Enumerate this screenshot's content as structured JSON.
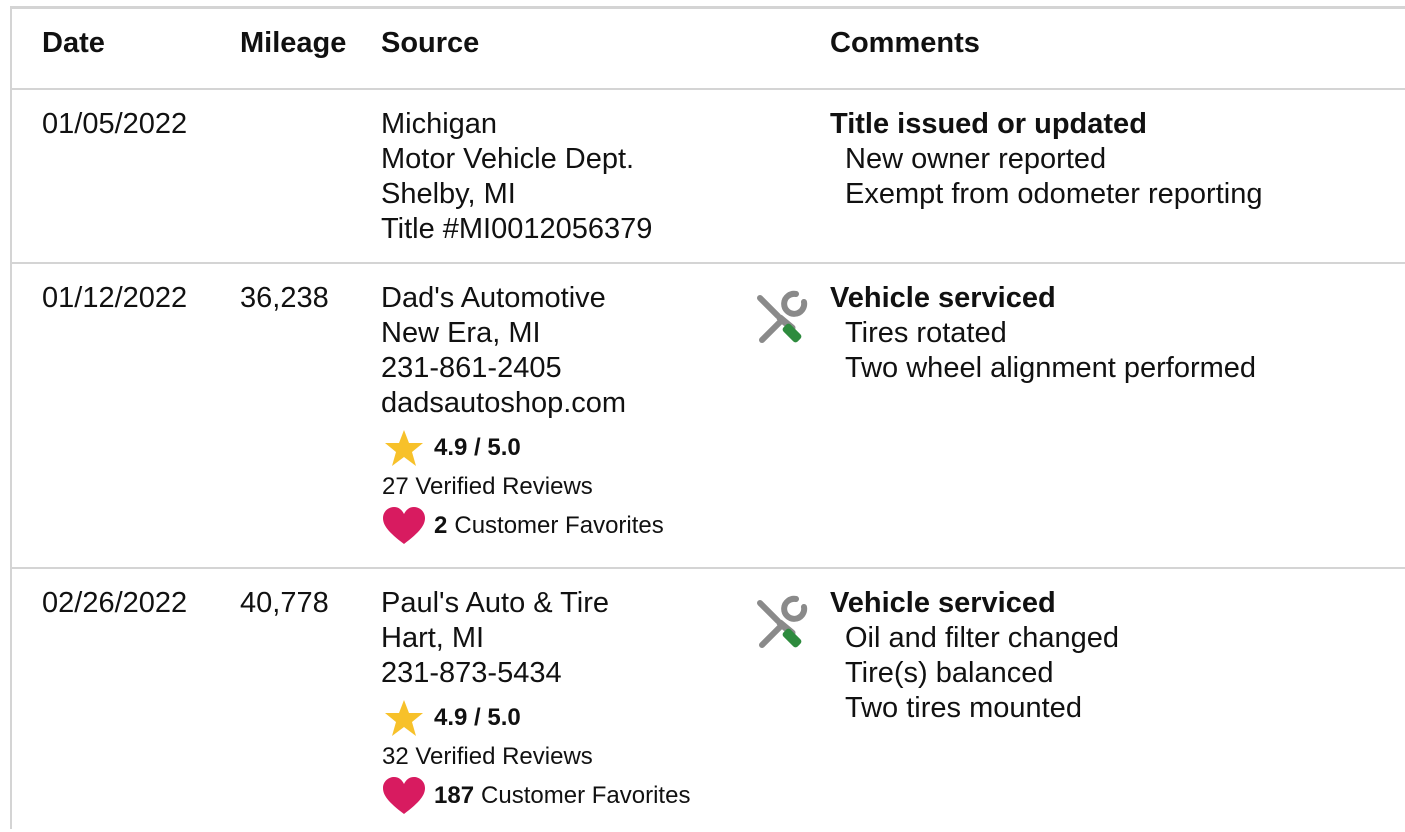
{
  "headers": {
    "date": "Date",
    "mileage": "Mileage",
    "source": "Source",
    "comments": "Comments"
  },
  "rows": [
    {
      "date": "01/05/2022",
      "mileage": "",
      "source": [
        "Michigan",
        "Motor Vehicle Dept.",
        "Shelby, MI",
        "Title #MI0012056379"
      ],
      "icon": "",
      "comment_title": "Title issued or updated",
      "comment_details": [
        "New owner reported",
        "Exempt from odometer reporting"
      ]
    },
    {
      "date": "01/12/2022",
      "mileage": "36,238",
      "source": [
        "Dad's Automotive",
        "New Era, MI",
        "231-861-2405",
        "dadsautoshop.com"
      ],
      "rating": "4.9 / 5.0",
      "reviews": "27 Verified Reviews",
      "favorites_count": "2",
      "favorites_label": "Customer Favorites",
      "icon": "service-tools-icon",
      "comment_title": "Vehicle serviced",
      "comment_details": [
        "Tires rotated",
        "Two wheel alignment performed"
      ]
    },
    {
      "date": "02/26/2022",
      "mileage": "40,778",
      "source": [
        "Paul's Auto & Tire",
        "Hart, MI",
        "231-873-5434"
      ],
      "rating": "4.9 / 5.0",
      "reviews": "32 Verified Reviews",
      "favorites_count": "187",
      "favorites_label": "Customer Favorites",
      "icon": "service-tools-icon",
      "comment_title": "Vehicle serviced",
      "comment_details": [
        "Oil and filter changed",
        "Tire(s) balanced",
        "Two tires mounted"
      ]
    }
  ],
  "colors": {
    "star": "#f7c12a",
    "heart": "#d81b60",
    "wrench": "#8a8a8a",
    "screwdriver": "#2e8b3e",
    "border": "#d4d4d4"
  }
}
